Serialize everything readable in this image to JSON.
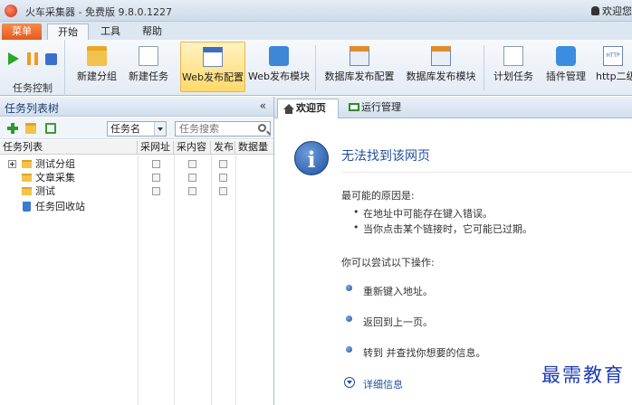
{
  "titlebar": {
    "title": "火车采集器 - 免费版 9.8.0.1227",
    "user": "欢迎您"
  },
  "ribbon_tabs": {
    "menu": "菜单",
    "start": "开始",
    "tools": "工具",
    "help": "帮助"
  },
  "ribbon": {
    "control_group_label": "任务控制",
    "buttons": [
      {
        "label": "新建分组",
        "icon": "folder-icon"
      },
      {
        "label": "新建任务",
        "icon": "document-icon"
      },
      {
        "label": "Web发布配置",
        "icon": "web-config-icon",
        "active": true
      },
      {
        "label": "Web发布模块",
        "icon": "web-module-icon"
      },
      {
        "label": "数据库发布配置",
        "icon": "database-config-icon"
      },
      {
        "label": "数据库发布模块",
        "icon": "database-module-icon"
      },
      {
        "label": "计划任务",
        "icon": "schedule-icon"
      },
      {
        "label": "插件管理",
        "icon": "plugin-icon"
      },
      {
        "label": "http二级",
        "icon": "http-icon"
      }
    ]
  },
  "left_panel": {
    "title": "任务列表树",
    "collapse": "«",
    "select_value": "任务名",
    "search_placeholder": "任务搜索",
    "columns": [
      "任务列表",
      "采网址",
      "采内容",
      "发布",
      "数据量"
    ],
    "tree": [
      {
        "label": "测试分组",
        "type": "group"
      },
      {
        "label": "文章采集",
        "type": "folder"
      },
      {
        "label": "测试",
        "type": "folder"
      },
      {
        "label": "任务回收站",
        "type": "trash"
      }
    ]
  },
  "right_panel": {
    "tabs": {
      "welcome": "欢迎页",
      "run": "运行管理"
    },
    "error": {
      "title": "无法找到该网页",
      "reasons_heading": "最可能的原因是:",
      "reasons": [
        "在地址中可能存在键入错误。",
        "当你点击某个链接时，它可能已过期。"
      ],
      "try_heading": "你可以尝试以下操作:",
      "actions": [
        "重新键入地址。",
        "返回到上一页。",
        "转到  并查找你想要的信息。"
      ],
      "details": "详细信息"
    }
  },
  "watermark": "最需教育"
}
